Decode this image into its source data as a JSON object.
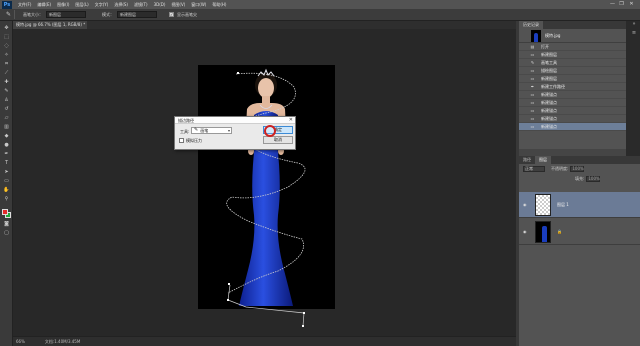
{
  "app": {
    "logo": "Ps"
  },
  "menu": [
    "文件(F)",
    "编辑(E)",
    "图像(I)",
    "图层(L)",
    "文字(Y)",
    "选择(S)",
    "滤镜(T)",
    "3D(D)",
    "视图(V)",
    "窗口(W)",
    "帮助(H)"
  ],
  "window_controls": {
    "minimize": "—",
    "restore": "❐",
    "close": "✕"
  },
  "options_bar": {
    "tool_icon": "brush-icon",
    "size_label": "画笔大小：",
    "mode_dropdown": "新图层",
    "sample_label": "模式：",
    "sample_dropdown": "新建图层",
    "checkbox_label": "显示画笔尖"
  },
  "document_tab": {
    "label": "模特.jpg @ 66.7% (图层 1, RGB/8) *"
  },
  "status_bar": {
    "zoom": "66%",
    "doc_info": "文档:1.40M/3.45M"
  },
  "history_panel": {
    "tabs": [
      "历史记录"
    ],
    "snapshot_label": "模特.jpg",
    "items": [
      {
        "label": "打开",
        "icon": "file-icon"
      },
      {
        "label": "新建图层",
        "icon": "layer-icon"
      },
      {
        "label": "画笔工具",
        "icon": "brush-icon"
      },
      {
        "label": "描绘图层",
        "icon": "layer-icon"
      },
      {
        "label": "新建图层",
        "icon": "layer-icon"
      },
      {
        "label": "新建工作路径",
        "icon": "pen-icon"
      },
      {
        "label": "新建锚点",
        "icon": "layer-icon"
      },
      {
        "label": "新建锚点",
        "icon": "layer-icon"
      },
      {
        "label": "新建锚点",
        "icon": "layer-icon"
      },
      {
        "label": "新建锚点",
        "icon": "layer-icon"
      },
      {
        "label": "新建锚点",
        "icon": "layer-icon",
        "selected": true
      }
    ]
  },
  "layers_panel": {
    "tabs": [
      "路径",
      "图层"
    ],
    "active_tab": "图层",
    "kind_dropdown": "正常",
    "opacity_label": "不透明度:",
    "opacity_value": "100%",
    "fill_label": "填充:",
    "fill_value": "100%",
    "layers": [
      {
        "name": "图层 1",
        "selected": true
      },
      {
        "name": "",
        "locked": true
      }
    ]
  },
  "dialog": {
    "title": "描边路径",
    "close": "✕",
    "tool_label": "工具:",
    "tool_value": "画笔",
    "checkbox_label": "模拟压力",
    "ok_label": "确定",
    "cancel_label": "取消"
  },
  "colors": {
    "foreground": "#e22a2a",
    "background": "#1ea83c",
    "accent": "#3c8bd6"
  }
}
